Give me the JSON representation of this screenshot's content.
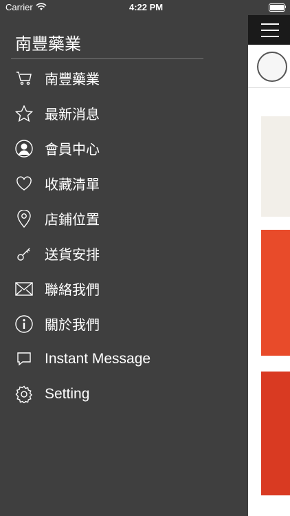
{
  "status_bar": {
    "carrier": "Carrier",
    "time": "4:22 PM"
  },
  "drawer": {
    "title": "南豐藥業",
    "items": [
      {
        "label": "南豐藥業",
        "icon": "cart-icon"
      },
      {
        "label": "最新消息",
        "icon": "star-icon"
      },
      {
        "label": "會員中心",
        "icon": "user-icon"
      },
      {
        "label": "收藏清單",
        "icon": "heart-icon"
      },
      {
        "label": "店鋪位置",
        "icon": "location-pin-icon"
      },
      {
        "label": "送貨安排",
        "icon": "key-icon"
      },
      {
        "label": "聯絡我們",
        "icon": "mail-icon"
      },
      {
        "label": "關於我們",
        "icon": "info-icon"
      },
      {
        "label": "Instant Message",
        "icon": "chat-bubble-icon"
      },
      {
        "label": "Setting",
        "icon": "gear-icon"
      }
    ]
  },
  "colors": {
    "drawer_bg": "#3f3f3f",
    "topbar_bg": "#1a1a1a",
    "banner_red": "#e84b2a"
  }
}
